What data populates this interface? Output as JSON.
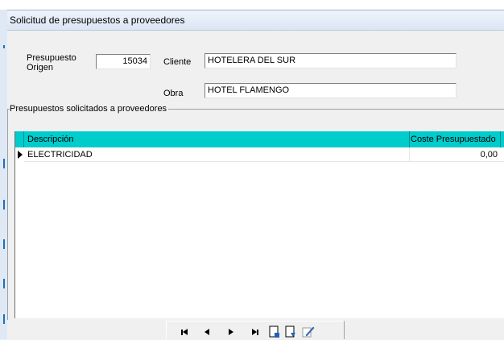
{
  "window": {
    "title": "Solicitud de presupuestos a proveedores"
  },
  "form": {
    "presupuesto_label_line1": "Presupuesto",
    "presupuesto_label_line2": "Origen",
    "presupuesto_value": "15034",
    "cliente_label": "Cliente",
    "cliente_value": "HOTELERA DEL SUR",
    "obra_label": "Obra",
    "obra_value": "HOTEL FLAMENGO"
  },
  "group": {
    "legend": "Presupuestos solicitados a proveedores"
  },
  "grid": {
    "columns": [
      "Descripción",
      "Coste Presupuestado"
    ],
    "rows": [
      {
        "descripcion": "ELECTRICIDAD",
        "coste": "0,00"
      }
    ],
    "header_color": "#00cccc"
  },
  "navigator": {
    "buttons": [
      "first-record-icon",
      "prior-record-icon",
      "next-record-icon",
      "last-record-icon",
      "insert-record-icon",
      "delete-record-icon",
      "edit-record-icon"
    ]
  }
}
